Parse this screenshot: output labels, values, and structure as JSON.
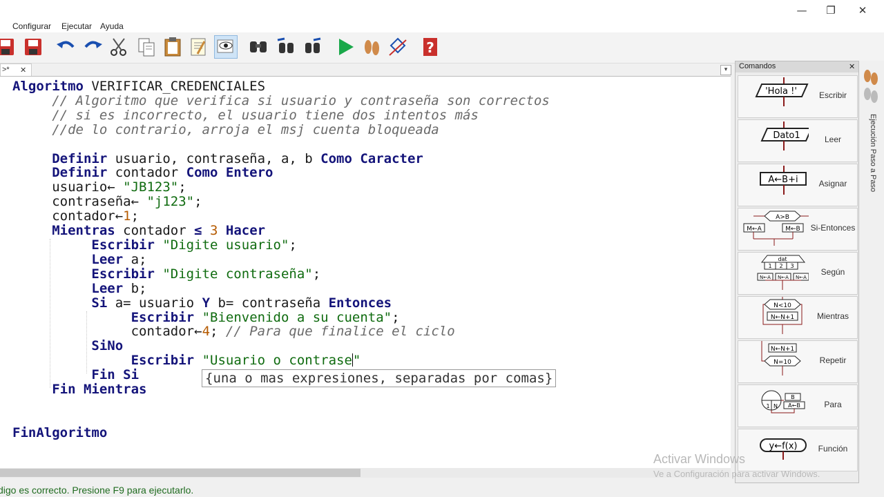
{
  "window": {
    "minimize": "—",
    "restore": "❐",
    "close": "✕"
  },
  "menu": [
    "Configurar",
    "Ejecutar",
    "Ayuda"
  ],
  "tab": {
    "label": ">*",
    "close": "✕"
  },
  "editor": {
    "lines": {
      "l1_kw": "Algoritmo",
      "l1_name": " VERIFICAR_CREDENCIALES",
      "c1": "// Algoritmo que verifica si usuario y contraseña son correctos",
      "c2": "// si es incorrecto, el usuario tiene dos intentos más",
      "c3": "//de lo contrario, arroja el msj cuenta bloqueada",
      "d1_kw": "Definir",
      "d1_vars": " usuario, contraseña, a, b ",
      "d1_como": "Como Caracter",
      "d2_kw": "Definir",
      "d2_vars": " contador ",
      "d2_como": "Como Entero",
      "a1_var": "usuario",
      "a1_str": "\"JB123\"",
      "a2_var": "contraseña",
      "a2_str": "\"j123\"",
      "a3_var": "contador",
      "a3_num": "1",
      "m_kw": "Mientras",
      "m_var": " contador ",
      "m_op": "≤",
      "m_num": "3",
      "m_hacer": "Hacer",
      "e1_kw": "Escribir",
      "e1_str": "\"Digite usuario\"",
      "r1_kw": "Leer",
      "r1_var": " a;",
      "e2_kw": "Escribir",
      "e2_str": "\"Digite contraseña\"",
      "r2_kw": "Leer",
      "r2_var": " b;",
      "si_kw": "Si",
      "si_cond": " a= usuario ",
      "si_y": "Y",
      "si_cond2": " b= contraseña ",
      "si_ent": "Entonces",
      "e3_kw": "Escribir",
      "e3_str": "\"Bienvenido a su cuenta\"",
      "a4_var": "contador",
      "a4_num": "4",
      "a4_cm": "// Para que finalice el ciclo",
      "sino_kw": "SiNo",
      "e4_kw": "Escribir",
      "e4_str": "\"Usuario o contrase",
      "e4_str_end": "\"",
      "finsi_kw": "Fin Si",
      "finm_kw": "Fin Mientras",
      "fin_kw": "FinAlgoritmo"
    },
    "tooltip": "{una o mas expresiones, separadas por comas}"
  },
  "status": "digo es correcto. Presione F9 para ejecutarlo.",
  "panel": {
    "title": "Comandos",
    "close": "✕",
    "commands": [
      {
        "label": "Escribir",
        "shape": "'Hola !'"
      },
      {
        "label": "Leer",
        "shape": "Dato1"
      },
      {
        "label": "Asignar",
        "shape": "A←B+i"
      },
      {
        "label": "Si-Entonces",
        "shape": "A>B",
        "a": "M←A",
        "b": "M←B"
      },
      {
        "label": "Según",
        "shape": "dat",
        "c1": "1",
        "c2": "2",
        "c3": "3",
        "a": "N←A"
      },
      {
        "label": "Mientras",
        "shape": "N<10",
        "a": "N←N+1"
      },
      {
        "label": "Repetir",
        "shape": "N=10",
        "a": "N←N+1"
      },
      {
        "label": "Para",
        "a": "B",
        "b": "A←B",
        "c": "1",
        "d": "N"
      },
      {
        "label": "Función",
        "shape": "y←f(x)"
      }
    ]
  },
  "side_label": "Ejecución Paso a Paso",
  "watermark": {
    "line1": "Activar Windows",
    "line2": "Ve a Configuración para activar Windows."
  },
  "colors": {
    "keyword": "#14147a",
    "string": "#0f6b0f",
    "number": "#b55a00",
    "comment": "#6a6a6a",
    "status": "#1f6b1f",
    "play": "#1aa84a"
  }
}
